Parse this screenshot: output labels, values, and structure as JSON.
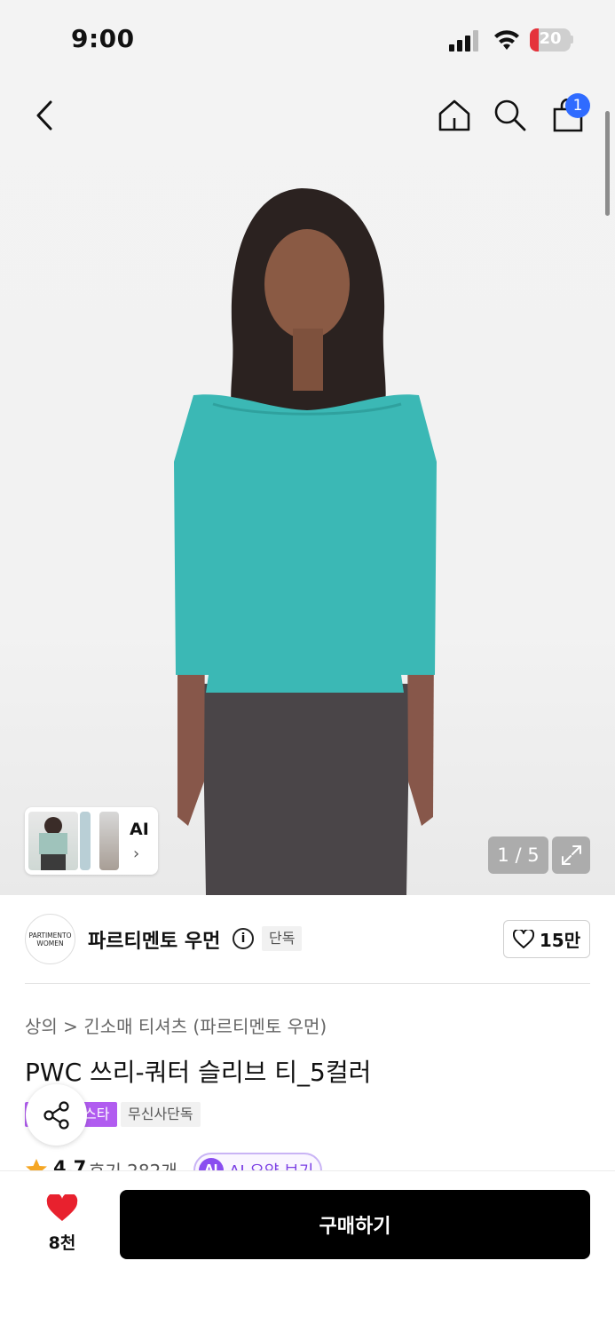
{
  "status_bar": {
    "time": "9:00",
    "battery": "20"
  },
  "nav": {
    "cart_count": "1"
  },
  "gallery": {
    "counter": "1 / 5",
    "ai_label": "AI"
  },
  "brand": {
    "logo_text_line1": "PARTIMENTO",
    "logo_text_line2": "WOMEN",
    "name": "파르티멘토 우먼",
    "exclusive_tag": "단독",
    "like_count": "15만"
  },
  "product": {
    "breadcrumb_category": "상의",
    "breadcrumb_separator": ">",
    "breadcrumb_sub": "긴소매 티셔츠 (파르티멘토 우먼)",
    "title": "PWC 쓰리-쿼터 슬리브 티_5컬러",
    "badge_purple": "스타",
    "badge_exclusive": "무신사단독"
  },
  "rating": {
    "score": "4.7",
    "reviews": "후기 282개",
    "ai_summary": "AI 요약 보기",
    "ai_icon_label": "AI"
  },
  "bottom": {
    "wish_count": "8천",
    "buy_label": "구매하기"
  },
  "colors": {
    "accent_blue": "#2f6bff",
    "heart_red": "#e8212e",
    "purple": "#b15cf0",
    "shirt_teal": "#3bb8b5"
  }
}
